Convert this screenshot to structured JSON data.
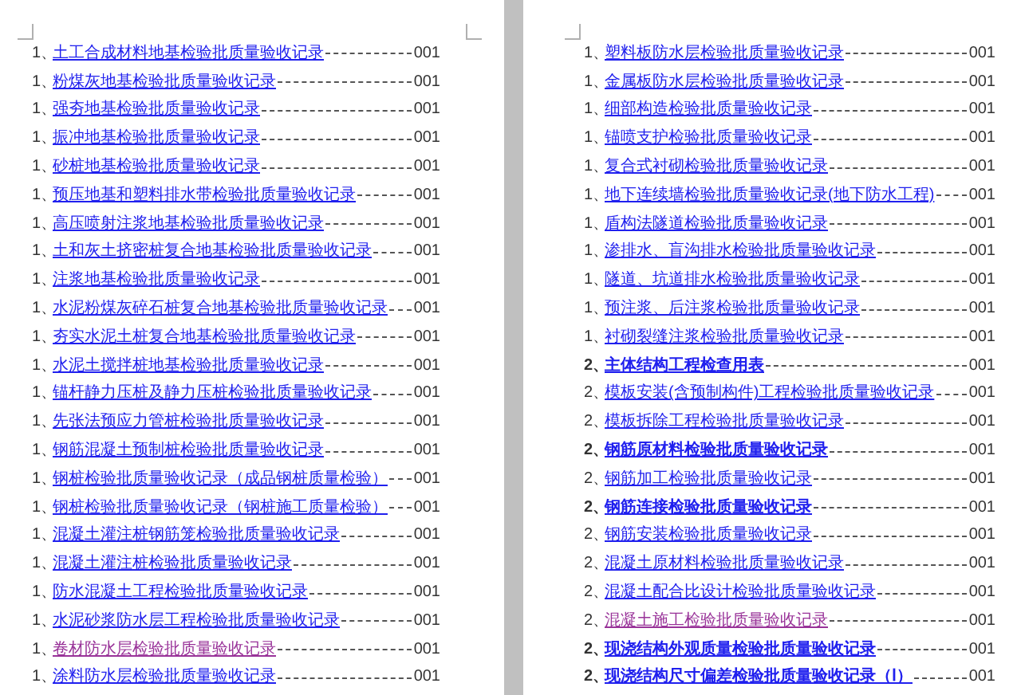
{
  "pages": [
    {
      "entries": [
        {
          "number": "1、",
          "title": "土工合成材料地基检验批质量验收记录",
          "page": "001",
          "bold": false,
          "visited": false
        },
        {
          "number": "1、",
          "title": "粉煤灰地基检验批质量验收记录",
          "page": "001",
          "bold": false,
          "visited": false
        },
        {
          "number": "1、",
          "title": "强夯地基检验批质量验收记录",
          "page": "001",
          "bold": false,
          "visited": false
        },
        {
          "number": "1、",
          "title": "振冲地基检验批质量验收记录",
          "page": "001",
          "bold": false,
          "visited": false
        },
        {
          "number": "1、",
          "title": "砂桩地基检验批质量验收记录",
          "page": "001",
          "bold": false,
          "visited": false
        },
        {
          "number": "1、",
          "title": "预压地基和塑料排水带检验批质量验收记录",
          "page": "001",
          "bold": false,
          "visited": false
        },
        {
          "number": "1、",
          "title": "高压喷射注浆地基检验批质量验收记录",
          "page": "001",
          "bold": false,
          "visited": false
        },
        {
          "number": "1、",
          "title": "土和灰土挤密桩复合地基检验批质量验收记录",
          "page": "001",
          "bold": false,
          "visited": false
        },
        {
          "number": "1、",
          "title": "注浆地基检验批质量验收记录",
          "page": "001",
          "bold": false,
          "visited": false
        },
        {
          "number": "1、",
          "title": "水泥粉煤灰碎石桩复合地基检验批质量验收记录",
          "page": "001",
          "bold": false,
          "visited": false
        },
        {
          "number": "1、",
          "title": "夯实水泥土桩复合地基检验批质量验收记录",
          "page": "001",
          "bold": false,
          "visited": false
        },
        {
          "number": "1、",
          "title": "水泥土搅拌桩地基检验批质量验收记录",
          "page": "001",
          "bold": false,
          "visited": false
        },
        {
          "number": "1、",
          "title": "锚杆静力压桩及静力压桩检验批质量验收记录",
          "page": "001",
          "bold": false,
          "visited": false
        },
        {
          "number": "1、",
          "title": "先张法预应力管桩检验批质量验收记录",
          "page": "001",
          "bold": false,
          "visited": false
        },
        {
          "number": "1、",
          "title": "钢筋混凝土预制桩检验批质量验收记录",
          "page": "001",
          "bold": false,
          "visited": false
        },
        {
          "number": "1、",
          "title": "钢桩检验批质量验收记录（成品钢桩质量检验）",
          "page": "001",
          "bold": false,
          "visited": false
        },
        {
          "number": "1、",
          "title": "钢桩检验批质量验收记录（钢桩施工质量检验）",
          "page": "001",
          "bold": false,
          "visited": false
        },
        {
          "number": "1、",
          "title": "混凝土灌注桩钢筋笼检验批质量验收记录",
          "page": "001",
          "bold": false,
          "visited": false
        },
        {
          "number": "1、",
          "title": "混凝土灌注桩检验批质量验收记录",
          "page": "001",
          "bold": false,
          "visited": false
        },
        {
          "number": "1、",
          "title": "防水混凝土工程检验批质量验收记录",
          "page": "001",
          "bold": false,
          "visited": false
        },
        {
          "number": "1、",
          "title": "水泥砂浆防水层工程检验批质量验收记录",
          "page": "001",
          "bold": false,
          "visited": false
        },
        {
          "number": "1、",
          "title": "卷材防水层检验批质量验收记录",
          "page": "001",
          "bold": false,
          "visited": true
        },
        {
          "number": "1、",
          "title": "涂料防水层检验批质量验收记录",
          "page": "001",
          "bold": false,
          "visited": false
        }
      ]
    },
    {
      "entries": [
        {
          "number": "1、",
          "title": "塑料板防水层检验批质量验收记录",
          "page": "001",
          "bold": false,
          "visited": false
        },
        {
          "number": "1、",
          "title": "金属板防水层检验批质量验收记录",
          "page": "001",
          "bold": false,
          "visited": false
        },
        {
          "number": "1、",
          "title": "细部构造检验批质量验收记录",
          "page": "001",
          "bold": false,
          "visited": false
        },
        {
          "number": "1、",
          "title": "锚喷支护检验批质量验收记录",
          "page": "001",
          "bold": false,
          "visited": false
        },
        {
          "number": "1、",
          "title": "复合式衬砌检验批质量验收记录",
          "page": "001",
          "bold": false,
          "visited": false
        },
        {
          "number": "1、",
          "title": "地下连续墙检验批质量验收记录(地下防水工程)",
          "page": "001",
          "bold": false,
          "visited": false
        },
        {
          "number": "1、",
          "title": "盾构法隧道检验批质量验收记录",
          "page": "001",
          "bold": false,
          "visited": false
        },
        {
          "number": "1、",
          "title": "渗排水、盲沟排水检验批质量验收记录",
          "page": "001",
          "bold": false,
          "visited": false
        },
        {
          "number": "1、",
          "title": "隧道、坑道排水检验批质量验收记录",
          "page": "001",
          "bold": false,
          "visited": false
        },
        {
          "number": "1、",
          "title": "预注浆、后注浆检验批质量验收记录",
          "page": "001",
          "bold": false,
          "visited": false
        },
        {
          "number": "1、",
          "title": "衬砌裂缝注浆检验批质量验收记录",
          "page": "001",
          "bold": false,
          "visited": false
        },
        {
          "number": "2、",
          "title": "主体结构工程检查用表",
          "page": "001",
          "bold": true,
          "visited": false
        },
        {
          "number": "2、",
          "title": "模板安装(含预制构件)工程检验批质量验收记录",
          "page": "001",
          "bold": false,
          "visited": false
        },
        {
          "number": "2、",
          "title": "模板拆除工程检验批质量验收记录",
          "page": "001",
          "bold": false,
          "visited": false
        },
        {
          "number": "2、",
          "title": "钢筋原材料检验批质量验收记录",
          "page": "001",
          "bold": true,
          "visited": false
        },
        {
          "number": "2、",
          "title": "钢筋加工检验批质量验收记录",
          "page": "001",
          "bold": false,
          "visited": false
        },
        {
          "number": "2、",
          "title": "钢筋连接检验批质量验收记录",
          "page": "001",
          "bold": true,
          "visited": false
        },
        {
          "number": "2、",
          "title": "钢筋安装检验批质量验收记录",
          "page": "001",
          "bold": false,
          "visited": false
        },
        {
          "number": "2、",
          "title": "混凝土原材料检验批质量验收记录",
          "page": "001",
          "bold": false,
          "visited": false
        },
        {
          "number": "2、",
          "title": "混凝土配合比设计检验批质量验收记录",
          "page": "001",
          "bold": false,
          "visited": false
        },
        {
          "number": "2、",
          "title": "混凝土施工检验批质量验收记录",
          "page": "001",
          "bold": false,
          "visited": true
        },
        {
          "number": "2、",
          "title": "现浇结构外观质量检验批质量验收记录",
          "page": "001",
          "bold": true,
          "visited": false
        },
        {
          "number": "2、",
          "title": "现浇结构尺寸偏差检验批质量验收记录（Ⅰ）",
          "page": "001",
          "bold": true,
          "visited": false
        }
      ]
    }
  ]
}
